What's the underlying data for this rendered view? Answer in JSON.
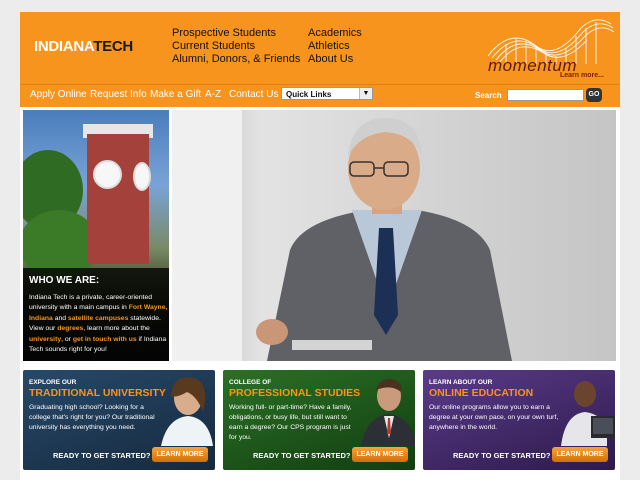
{
  "header": {
    "logo_part1": "INDIANA",
    "logo_part2": "TECH",
    "nav_col1": [
      "Prospective Students",
      "Current Students",
      "Alumni, Donors, & Friends"
    ],
    "nav_col2": [
      "Academics",
      "Athletics",
      "About Us"
    ],
    "momentum_text": "momentum",
    "momentum_learn": "Learn more..."
  },
  "subnav": {
    "links": [
      "Apply Online",
      "Request Info",
      "Make a Gift",
      "A-Z",
      "Contact Us"
    ],
    "quick_links": "Quick Links",
    "search_label": "Search",
    "go_label": "GO"
  },
  "who": {
    "heading": "WHO WE ARE:",
    "p1": "Indiana Tech is a private, career-oriented university with a main campus in",
    "link_fort": "Fort Wayne, Indiana",
    "and": "and",
    "link_satellite": "satellite campuses",
    "statewide": "statewide.",
    "view": "View our",
    "link_degrees": "degrees",
    "learn": ", learn more about the",
    "link_university": "university",
    "or": ", or",
    "link_touch": "get in touch with us",
    "end": "if Indiana Tech sounds right for you!"
  },
  "cards": [
    {
      "small": "EXPLORE OUR",
      "title": "TRADITIONAL UNIVERSITY",
      "body": "Graduating high school? Looking for a college that's right for you? Our traditional university has everything you need.",
      "ready": "READY TO GET STARTED?",
      "button": "LEARN MORE",
      "color": "#1f3d57"
    },
    {
      "small": "COLLEGE OF",
      "title": "PROFESSIONAL STUDIES",
      "body": "Working full- or part-time? Have a family, obligations, or busy life, but still want to earn a degree? Our CPS program is just for you.",
      "ready": "READY TO GET STARTED?",
      "button": "LEARN MORE",
      "color": "#1f5a1c"
    },
    {
      "small": "LEARN ABOUT OUR",
      "title": "ONLINE EDUCATION",
      "body": "Our online programs allow you to earn a degree at your own pace, on your own turf, anywhere in the world.",
      "ready": "READY TO GET STARTED?",
      "button": "LEARN MORE",
      "color": "#4a2a73"
    }
  ],
  "colors": {
    "brand_orange": "#f7941e",
    "logo_dark": "#1a1a1a"
  }
}
